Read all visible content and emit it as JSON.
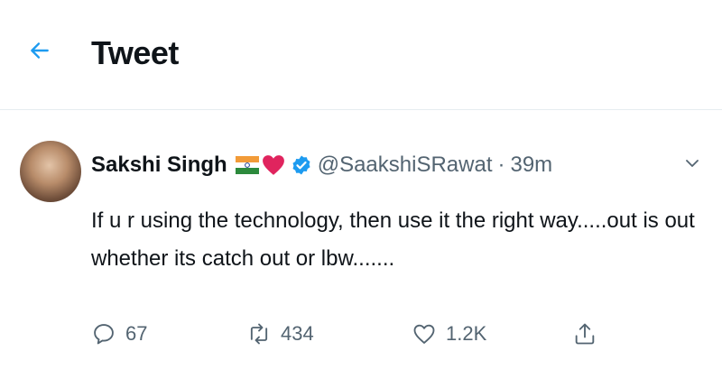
{
  "header": {
    "title": "Tweet",
    "back_icon": "arrow-left-icon",
    "accent_color": "#1d9bf0"
  },
  "tweet": {
    "author": {
      "display_name": "Sakshi Singh",
      "emojis": [
        "india-flag-emoji",
        "red-heart-emoji"
      ],
      "verified": true,
      "handle": "@SaakshiSRawat",
      "separator": "·",
      "time": "39m"
    },
    "text": "If u r using the technology, then use it the right way.....out is out whether its catch out or lbw.......",
    "actions": {
      "reply_count": "67",
      "retweet_count": "434",
      "like_count": "1.2K",
      "share_icon": "share-icon"
    }
  }
}
